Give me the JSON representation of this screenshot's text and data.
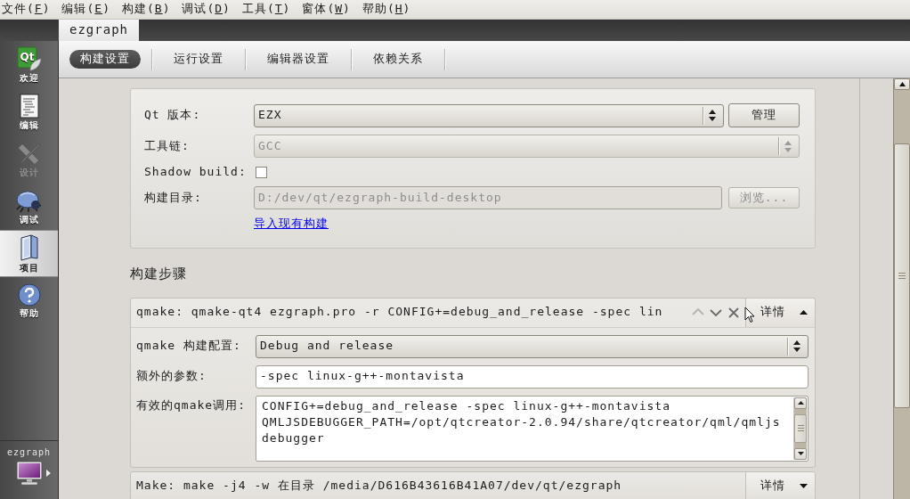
{
  "menu_bar": [
    {
      "label": "文件(",
      "key": "F",
      "tail": ")"
    },
    {
      "label": "编辑(",
      "key": "E",
      "tail": ")"
    },
    {
      "label": "构建(",
      "key": "B",
      "tail": ")"
    },
    {
      "label": "调试(",
      "key": "D",
      "tail": ")"
    },
    {
      "label": "工具(",
      "key": "T",
      "tail": ")"
    },
    {
      "label": "窗体(",
      "key": "W",
      "tail": ")"
    },
    {
      "label": "帮助(",
      "key": "H",
      "tail": ")"
    }
  ],
  "sidebar": {
    "items": [
      {
        "kind": "welcome",
        "icon_text": "Qt",
        "label": "欢迎",
        "selected": false,
        "disabled": false
      },
      {
        "kind": "edit",
        "label": "编辑",
        "selected": false,
        "disabled": false
      },
      {
        "kind": "design",
        "label": "设计",
        "selected": false,
        "disabled": true
      },
      {
        "kind": "debug",
        "label": "调试",
        "selected": false,
        "disabled": false
      },
      {
        "kind": "projects",
        "label": "项目",
        "selected": true,
        "disabled": false
      },
      {
        "kind": "help",
        "label": "帮助",
        "selected": false,
        "disabled": false
      }
    ],
    "target": {
      "project": "ezgraph"
    }
  },
  "project_tabs": [
    {
      "label": "ezgraph",
      "selected": true
    }
  ],
  "settings_tabs": [
    {
      "label": "构建设置",
      "selected": true
    },
    {
      "label": "运行设置",
      "selected": false
    },
    {
      "label": "编辑器设置",
      "selected": false
    },
    {
      "label": "依赖关系",
      "selected": false
    }
  ],
  "build_settings": {
    "qt_version": {
      "label": "Qt 版本:",
      "value": "EZX",
      "disabled": false,
      "button": {
        "label": "管理",
        "disabled": false
      }
    },
    "toolchain": {
      "label": "工具链:",
      "value": "GCC",
      "disabled": true
    },
    "shadow_build": {
      "label": "Shadow build:",
      "checked": false
    },
    "build_directory": {
      "label": "构建目录:",
      "value": "D:/dev/qt/ezgraph-build-desktop",
      "disabled": true,
      "button": {
        "label": "浏览...",
        "disabled": true
      }
    },
    "import_link": "导入现有构建"
  },
  "build_steps": {
    "title": "构建步骤",
    "steps": [
      {
        "summary": "qmake: qmake-qt4 ezgraph.pro -r CONFIG+=debug_and_release -spec lin",
        "expanded": true,
        "details_label": "详情",
        "actions": [
          {
            "kind": "up",
            "disabled": true
          },
          {
            "kind": "down",
            "disabled": false
          },
          {
            "kind": "remove",
            "disabled": false
          }
        ],
        "fields": [
          {
            "kind": "combo",
            "label": "qmake 构建配置:",
            "value": "Debug and release"
          },
          {
            "kind": "input",
            "label": "额外的参数:",
            "value": "-spec linux-g++-montavista"
          },
          {
            "kind": "textarea",
            "label": "有效的qmake调用:",
            "lines": [
              "CONFIG+=debug_and_release -spec linux-g++-montavista",
              "QMLJSDEBUGGER_PATH=/opt/qtcreator-2.0.94/share/qtcreator/qml/qmljs",
              "debugger"
            ]
          }
        ]
      },
      {
        "summary": "Make: make -j4 -w 在目录 /media/D616B43616B41A07/dev/qt/ezgraph",
        "expanded": false,
        "details_label": "详情"
      }
    ]
  }
}
